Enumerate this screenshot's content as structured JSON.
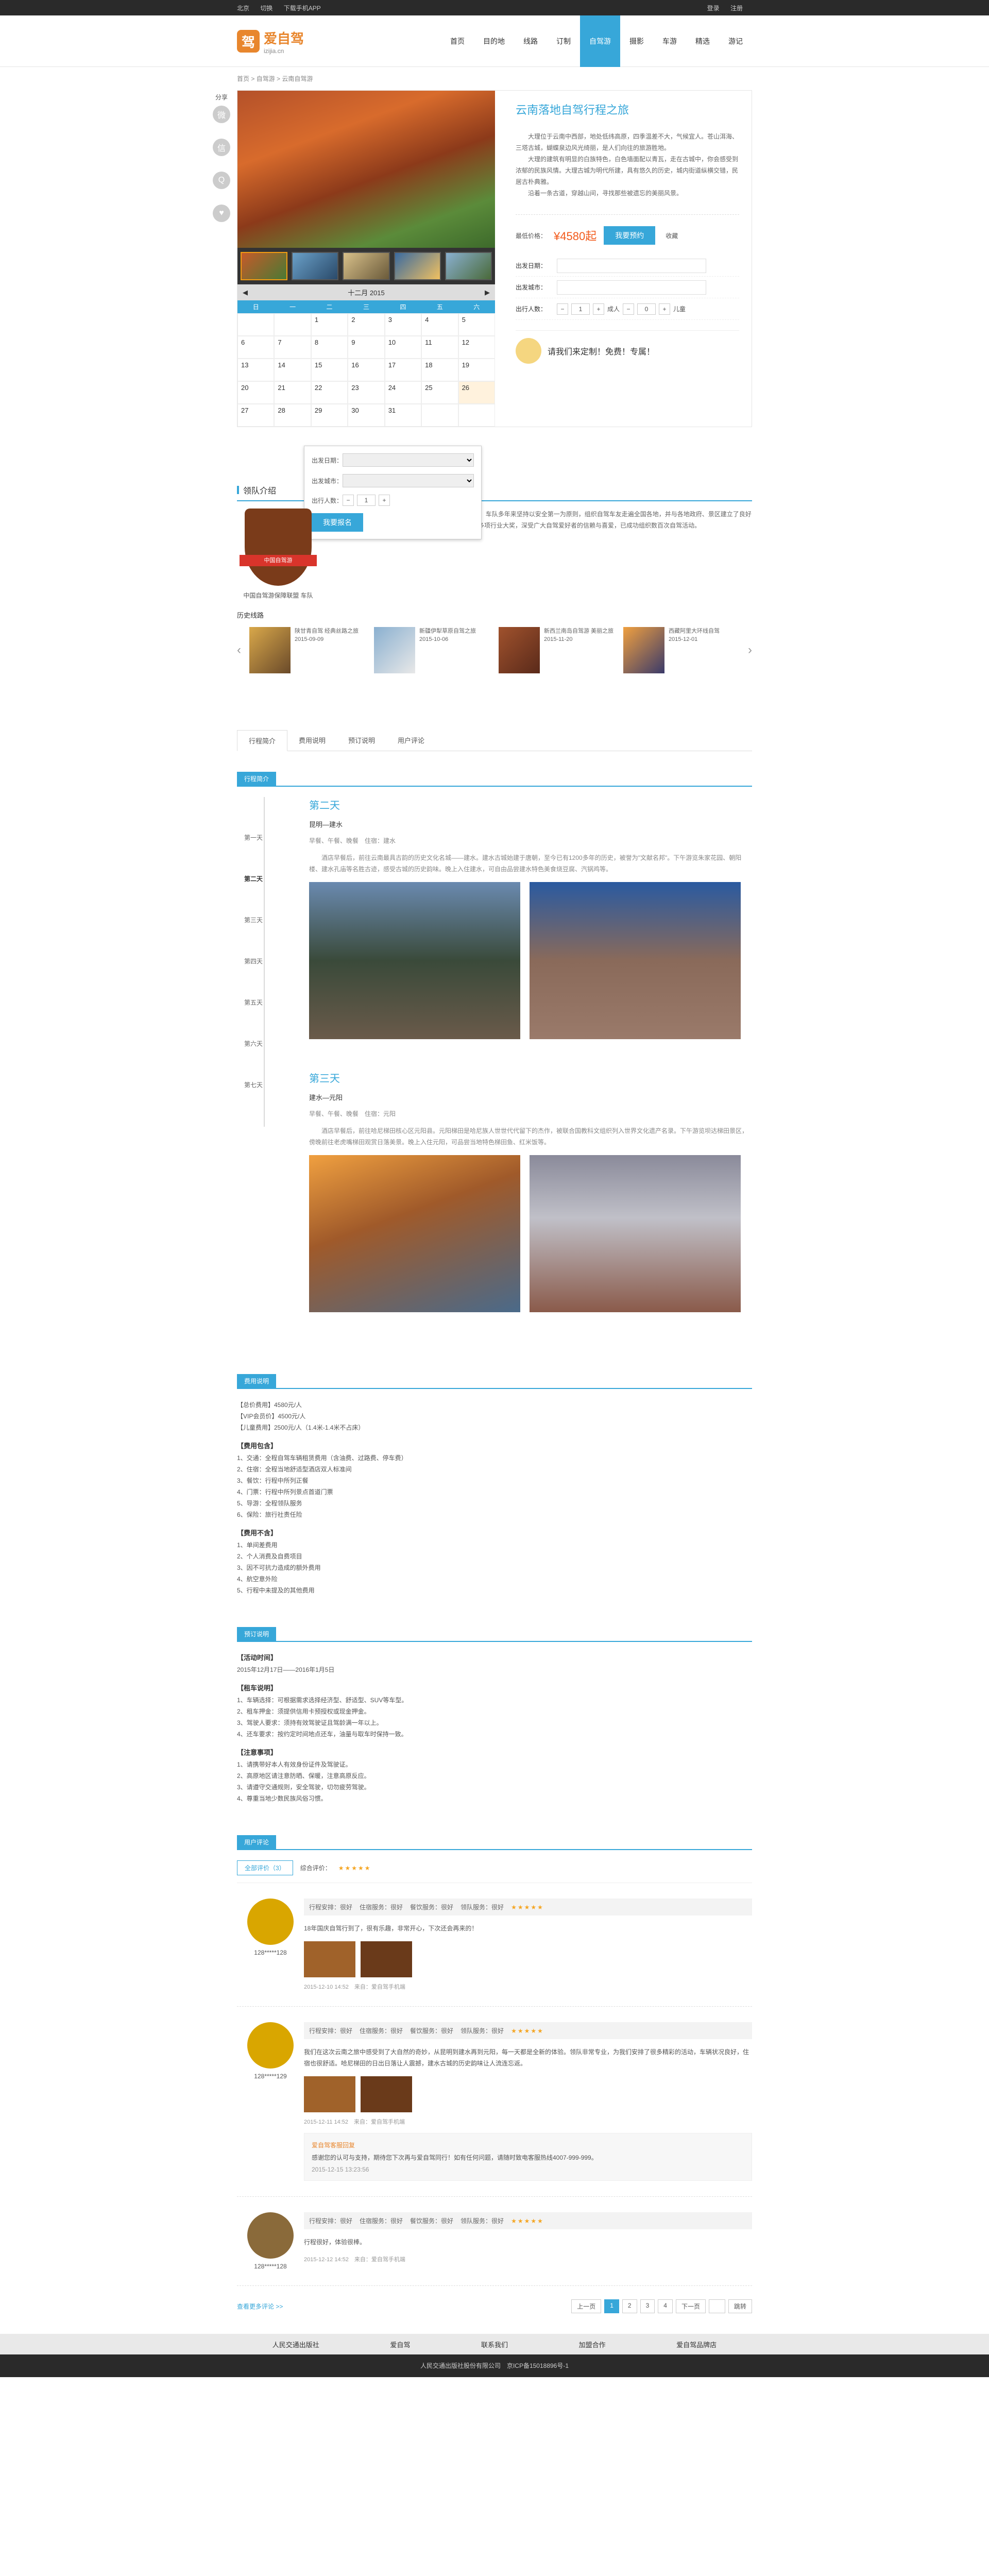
{
  "topbar": {
    "location": "北京",
    "switch": "切换",
    "app": "下载手机APP",
    "login": "登录",
    "register": "注册"
  },
  "logo": {
    "cn": "爱自驾",
    "en": "izijia.cn"
  },
  "nav": [
    "首页",
    "目的地",
    "线路",
    "订制",
    "自驾游",
    "摄影",
    "车游",
    "精选",
    "游记"
  ],
  "crumb": "首页 > 自驾游 > 云南自驾游",
  "share_label": "分享",
  "product": {
    "title": "云南落地自驾行程之旅",
    "intro1": "大理位于云南中西部，地处低纬高原，四季温差不大，气候宜人。苍山洱海、三塔古城，蝴蝶泉边风光绮丽，是人们向往的旅游胜地。",
    "intro2": "大理的建筑有明显的白族特色，白色墙面配以青瓦，走在古城中，你会感受到浓郁的民族风情。大理古城为明代所建，具有悠久的历史，城内街道纵横交错，民居古朴典雅。",
    "intro3": "沿着一条古道，穿越山间，寻找那些被遗忘的美丽风景。",
    "price_label": "最低价格：",
    "price": "¥4580起",
    "book_btn": "我要预约",
    "collect": "收藏",
    "date_label": "出发日期：",
    "city_label": "出发城市：",
    "people_label": "出行人数：",
    "adult": "成人",
    "child": "儿童",
    "consult": "请我们来定制！免费！专属！"
  },
  "calendar": {
    "month": "十二月 2015",
    "week": [
      "日",
      "一",
      "二",
      "三",
      "四",
      "五",
      "六"
    ],
    "days": [
      "",
      "",
      "1",
      "2",
      "3",
      "4",
      "5",
      "6",
      "7",
      "8",
      "9",
      "10",
      "11",
      "12",
      "13",
      "14",
      "15",
      "16",
      "17",
      "18",
      "19",
      "20",
      "21",
      "22",
      "23",
      "24",
      "25",
      "26",
      "27",
      "28",
      "29",
      "30",
      "31",
      "",
      ""
    ]
  },
  "popup": {
    "date": "出发日期：",
    "city": "出发城市：",
    "people": "出行人数：",
    "btn": "我要报名"
  },
  "team": {
    "title": "领队介绍",
    "badge_text": "中国自驾游",
    "name": "中国自驾游保障联盟 车队",
    "desc": "该车队成立于2008年，是中国最早的自驾游俱乐部之一。车队多年来坚持以安全第一为原则，组织自驾车友走遍全国各地，并与各地政府、景区建立了良好的合作关系，提供专业的领队服务与保障。车队曾荣获多项行业大奖，深受广大自驾爱好者的信赖与喜爱，已成功组织数百次自驾活动。",
    "history_title": "历史线路",
    "history": [
      {
        "title": "陕甘青自驾 经典丝路之旅",
        "date": "2015-09-09"
      },
      {
        "title": "新疆伊犁草原自驾之旅",
        "date": "2015-10-06"
      },
      {
        "title": "新西兰南岛自驾游 美丽之旅",
        "date": "2015-11-20"
      },
      {
        "title": "西藏阿里大环线自驾",
        "date": "2015-12-01"
      }
    ]
  },
  "tabs": [
    "行程简介",
    "费用说明",
    "预订说明",
    "用户评论"
  ],
  "itinerary": {
    "tag": "行程简介",
    "nodes": [
      "第一天",
      "第二天",
      "第三天",
      "第四天",
      "第五天",
      "第六天",
      "第七天"
    ],
    "days": [
      {
        "title": "第二天",
        "route": "昆明—建水",
        "meal": "早餐、午餐、晚餐　住宿：建水",
        "text": "酒店早餐后，前往云南最具古韵的历史文化名城——建水。建水古城始建于唐朝，至今已有1200多年的历史，被誉为\"文献名邦\"。下午游览朱家花园、朝阳楼、建水孔庙等名胜古迹，感受古城的历史韵味。晚上入住建水，可自由品尝建水特色美食烧豆腐、汽锅鸡等。"
      },
      {
        "title": "第三天",
        "route": "建水—元阳",
        "meal": "早餐、午餐、晚餐　住宿：元阳",
        "text": "酒店早餐后，前往哈尼梯田核心区元阳县。元阳梯田是哈尼族人世世代代留下的杰作，被联合国教科文组织列入世界文化遗产名录。下午游览坝达梯田景区，傍晚前往老虎嘴梯田观赏日落美景。晚上入住元阳，可品尝当地特色梯田鱼、红米饭等。"
      }
    ]
  },
  "fee": {
    "tag": "费用说明",
    "prices": [
      "【总价费用】4580元/人",
      "【VIP会员价】4500元/人",
      "【儿童费用】2500元/人（1.4米-1.4米不占床）"
    ],
    "incl_title": "【费用包含】",
    "incl": [
      "1、交通：全程自驾车辆租赁费用（含油费、过路费、停车费）",
      "2、住宿：全程当地舒适型酒店双人标准间",
      "3、餐饮：行程中所列正餐",
      "4、门票：行程中所列景点首道门票",
      "5、导游：全程领队服务",
      "6、保险：旅行社责任险"
    ],
    "excl_title": "【费用不含】",
    "excl": [
      "1、单间差费用",
      "2、个人消费及自费项目",
      "3、因不可抗力造成的额外费用",
      "4、航空意外险",
      "5、行程中未提及的其他费用"
    ]
  },
  "booking": {
    "tag": "预订说明",
    "act_title": "【活动时间】",
    "act": "2015年12月17日——2016年1月5日",
    "car_title": "【租车说明】",
    "car": [
      "1、车辆选择：可根据需求选择经济型、舒适型、SUV等车型。",
      "2、租车押金：须提供信用卡预授权或现金押金。",
      "3、驾驶人要求：须持有效驾驶证且驾龄满一年以上。",
      "4、还车要求：按约定时间地点还车，油量与取车时保持一致。"
    ],
    "note_title": "【注意事项】",
    "note": [
      "1、请携带好本人有效身份证件及驾驶证。",
      "2、高原地区请注意防晒、保暖，注意高原反应。",
      "3、请遵守交通规则，安全驾驶，切勿疲劳驾驶。",
      "4、尊重当地少数民族风俗习惯。"
    ]
  },
  "reviews": {
    "tag": "用户评论",
    "count_btn": "全部评价（3）",
    "overall": "综合评价：",
    "meta_labels": [
      "行程安排：很好",
      "住宿服务：很好",
      "餐饮服务：很好",
      "领队服务：很好"
    ],
    "items": [
      {
        "user": "128*****128",
        "text": "18年国庆自驾行到了，很有乐趣，非常开心，下次还会再来的！",
        "time": "2015-12-10 14:52　来自：爱自驾手机端"
      },
      {
        "user": "128*****129",
        "text": "我们在这次云南之旅中感受到了大自然的奇妙，从昆明到建水再到元阳，每一天都是全新的体验。领队非常专业，为我们安排了很多精彩的活动，车辆状况良好，住宿也很舒适。哈尼梯田的日出日落让人震撼，建水古城的历史韵味让人流连忘返。",
        "time": "2015-12-11 14:52　来自：爱自驾手机端",
        "reply_label": "爱自驾客服回复",
        "reply": "感谢您的认可与支持，期待您下次再与爱自驾同行！如有任何问题，请随时致电客服热线4007-999-999。",
        "reply_time": "2015-12-15 13:23:56"
      },
      {
        "user": "128*****128",
        "text": "行程很好，体验很棒。",
        "time": "2015-12-12 14:52　来自：爱自驾手机端"
      }
    ]
  },
  "pager": {
    "more": "查看更多评论 >>",
    "pages": [
      "上一页",
      "1",
      "2",
      "3",
      "4",
      "下一页"
    ],
    "go": "跳转"
  },
  "footer": [
    "人民交通出版社",
    "爱自驾",
    "联系我们",
    "加盟合作",
    "爱自驾品牌店"
  ],
  "copyright": "人民交通出版社股份有限公司　京ICP备15018896号-1"
}
